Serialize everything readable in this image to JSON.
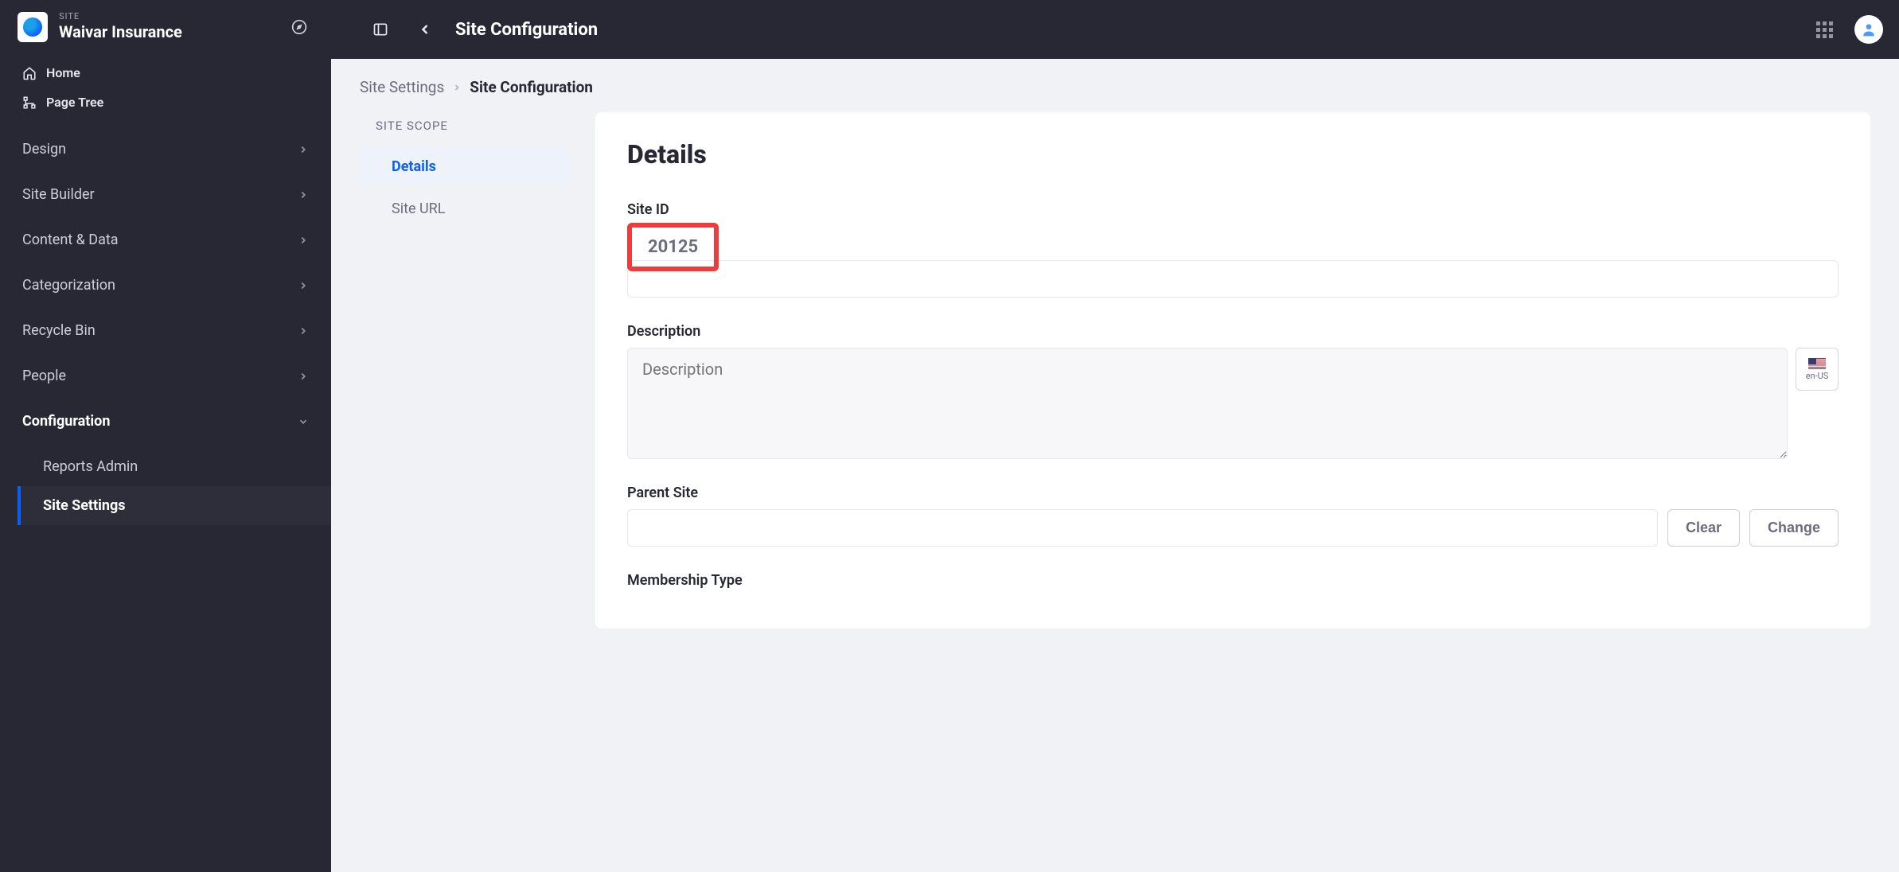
{
  "sidebar": {
    "eyebrow": "SITE",
    "site_title": "Waivar Insurance",
    "quick": {
      "home": "Home",
      "page_tree": "Page Tree"
    },
    "items": [
      {
        "label": "Design",
        "expanded": false
      },
      {
        "label": "Site Builder",
        "expanded": false
      },
      {
        "label": "Content & Data",
        "expanded": false
      },
      {
        "label": "Categorization",
        "expanded": false
      },
      {
        "label": "Recycle Bin",
        "expanded": false
      },
      {
        "label": "People",
        "expanded": false
      },
      {
        "label": "Configuration",
        "expanded": true,
        "children": [
          {
            "label": "Reports Admin",
            "active": false
          },
          {
            "label": "Site Settings",
            "active": true
          }
        ]
      }
    ]
  },
  "topbar": {
    "title": "Site Configuration"
  },
  "breadcrumbs": {
    "parent": "Site Settings",
    "current": "Site Configuration"
  },
  "sidemenu": {
    "heading": "SITE SCOPE",
    "items": [
      {
        "label": "Details",
        "active": true
      },
      {
        "label": "Site URL",
        "active": false
      }
    ]
  },
  "panel": {
    "heading": "Details",
    "site_id_label": "Site ID",
    "site_id_value": "20125",
    "description_label": "Description",
    "description_placeholder": "Description",
    "description_value": "",
    "locale_code": "en-US",
    "parent_site_label": "Parent Site",
    "parent_site_value": "",
    "clear_label": "Clear",
    "change_label": "Change",
    "membership_type_label": "Membership Type"
  }
}
